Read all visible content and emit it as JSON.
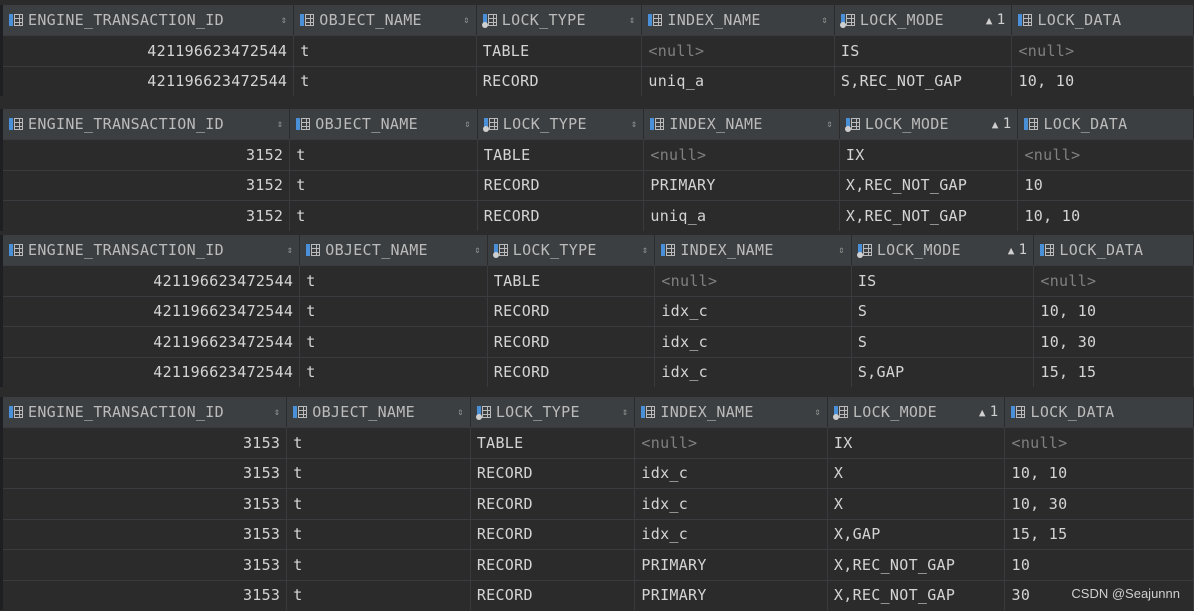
{
  "columns": {
    "c0": "ENGINE_TRANSACTION_ID",
    "c1": "OBJECT_NAME",
    "c2": "LOCK_TYPE",
    "c3": "INDEX_NAME",
    "c4": "LOCK_MODE",
    "c5": "LOCK_DATA"
  },
  "sort": {
    "order": "1",
    "asc_glyph": "▲",
    "both_glyph": "⇕"
  },
  "null_text": "<null>",
  "blocks": [
    {
      "rows": [
        [
          "421196623472544",
          "t",
          "TABLE",
          null,
          "IS",
          null
        ],
        [
          "421196623472544",
          "t",
          "RECORD",
          "uniq_a",
          "S,REC_NOT_GAP",
          "10, 10"
        ]
      ]
    },
    {
      "rows": [
        [
          "3152",
          "t",
          "TABLE",
          null,
          "IX",
          null
        ],
        [
          "3152",
          "t",
          "RECORD",
          "PRIMARY",
          "X,REC_NOT_GAP",
          "10"
        ],
        [
          "3152",
          "t",
          "RECORD",
          "uniq_a",
          "X,REC_NOT_GAP",
          "10, 10"
        ]
      ]
    },
    {
      "rows": [
        [
          "421196623472544",
          "t",
          "TABLE",
          null,
          "IS",
          null
        ],
        [
          "421196623472544",
          "t",
          "RECORD",
          "idx_c",
          "S",
          "10, 10"
        ],
        [
          "421196623472544",
          "t",
          "RECORD",
          "idx_c",
          "S",
          "10, 30"
        ],
        [
          "421196623472544",
          "t",
          "RECORD",
          "idx_c",
          "S,GAP",
          "15, 15"
        ]
      ]
    },
    {
      "rows": [
        [
          "3153",
          "t",
          "TABLE",
          null,
          "IX",
          null
        ],
        [
          "3153",
          "t",
          "RECORD",
          "idx_c",
          "X",
          "10, 10"
        ],
        [
          "3153",
          "t",
          "RECORD",
          "idx_c",
          "X",
          "10, 30"
        ],
        [
          "3153",
          "t",
          "RECORD",
          "idx_c",
          "X,GAP",
          "15, 15"
        ],
        [
          "3153",
          "t",
          "RECORD",
          "PRIMARY",
          "X,REC_NOT_GAP",
          "10"
        ],
        [
          "3153",
          "t",
          "RECORD",
          "PRIMARY",
          "X,REC_NOT_GAP",
          "30"
        ]
      ]
    }
  ],
  "watermark": "CSDN @Seajunnn",
  "colors": {
    "background": "#2b2b2b",
    "header": "#3c3f41",
    "icon_accent": "#4a90d9",
    "null": "#808080"
  }
}
